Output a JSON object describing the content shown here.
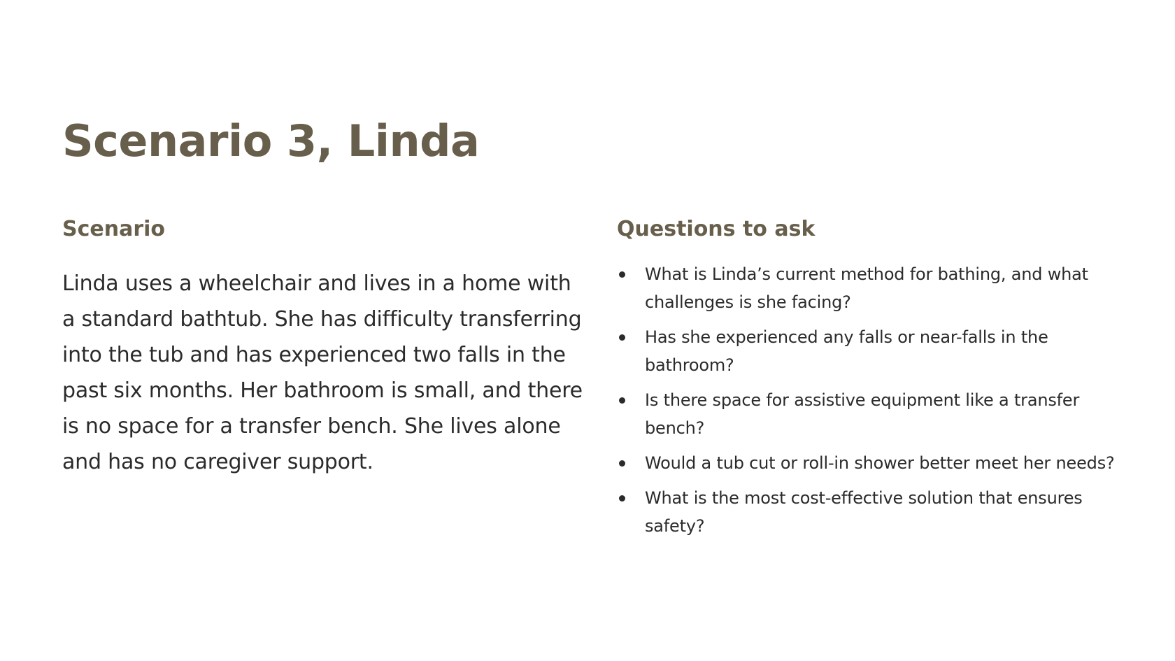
{
  "slide": {
    "title": "Scenario 3, Linda",
    "scenario": {
      "heading": "Scenario",
      "text": "Linda uses a wheelchair and lives in a home with a standard bathtub. She has difficulty transferring into the tub and has experienced two falls in the past six months. Her bathroom is small, and there is no space for a transfer bench. She lives alone and has no caregiver support."
    },
    "questions": {
      "heading": "Questions to ask",
      "items": [
        "What is Linda’s current method for bathing, and what challenges is she facing?",
        "Has she experienced any falls or near-falls in the bathroom?",
        "Is there space for assistive equipment like a transfer bench?",
        "Would a tub cut or roll-in shower better meet her needs?",
        "What is the most cost-effective solution that ensures safety?"
      ]
    }
  },
  "colors": {
    "accent": "#675f4b",
    "body_text": "#2b2b2b",
    "background": "#ffffff"
  }
}
